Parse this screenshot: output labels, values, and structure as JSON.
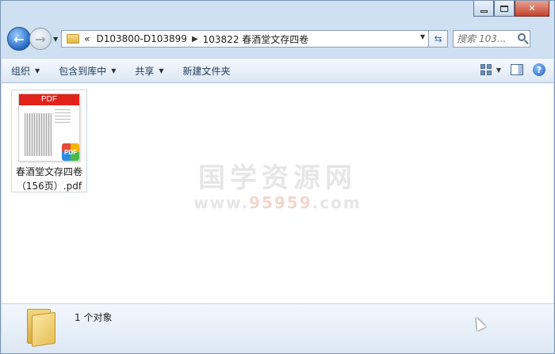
{
  "window": {
    "caption": {
      "minimize": "minimize",
      "maximize": "maximize",
      "close": "close"
    }
  },
  "nav": {
    "back_icon": "arrow-left-icon",
    "forward_icon": "arrow-right-icon",
    "breadcrumb_prefix": "«",
    "breadcrumbs": [
      "D103800-D103899",
      "103822 春酒堂文存四卷"
    ],
    "search_placeholder": "搜索 103..."
  },
  "toolbar": {
    "organize": "组织",
    "include_library": "包含到库中",
    "share": "共享",
    "new_folder": "新建文件夹"
  },
  "content": {
    "files": [
      {
        "name_line1": "春酒堂文存四卷",
        "name_line2": "（156页）.pdf",
        "thumb_banner": "PDF",
        "badge": "PDF"
      }
    ],
    "watermark_title": "国学资源网",
    "watermark_url_a": "www.",
    "watermark_url_b": "95959",
    "watermark_url_c": ".com"
  },
  "status": {
    "count_text": "1 个对象"
  },
  "colors": {
    "pdf_red": "#e1221a",
    "chrome_blue": "#cfe0f3"
  }
}
